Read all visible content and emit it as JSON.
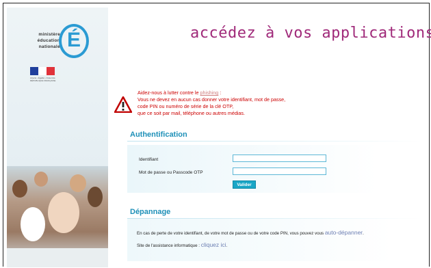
{
  "logo": {
    "ministry_lines": [
      "ministère",
      "éducation",
      "nationale"
    ],
    "letter": "É",
    "rf_caption": "Liberté • Égalité • Fraternité RÉPUBLIQUE FRANÇAISE"
  },
  "header": {
    "title": "accédez à vos applications"
  },
  "warning": {
    "line1_prefix": "Aidez-nous à lutter contre le ",
    "line1_link": "phishing",
    "line1_suffix": " :",
    "line2": "Vous ne devez en aucun cas donner votre identifiant, mot de passe,",
    "line3": "code PIN ou numéro de série de la clé OTP,",
    "line4": "que ce soit par mail, téléphone ou autres médias."
  },
  "auth": {
    "title": "Authentification",
    "id_label": "Identifiant",
    "pwd_label": "Mot de passe ou Passcode OTP",
    "id_value": "",
    "pwd_value": "",
    "submit_label": "Valider"
  },
  "help": {
    "title": "Dépannage",
    "line1_text": "En cas de perte de votre identifiant, de votre mot de passe ou de votre code PIN, vous pouvez vous ",
    "line1_link": "auto-dépanner",
    "line1_end": ".",
    "line2_text": "Site de l'assistance informatique : ",
    "line2_link": "cliquez ici",
    "line2_end": "."
  },
  "colors": {
    "title": "#a02a7a",
    "accent": "#1e90b8",
    "warning": "#cc0000",
    "button": "#1aa6c6",
    "link": "#6d7fb3"
  },
  "icons": {
    "warning": "warning-triangle-icon"
  }
}
